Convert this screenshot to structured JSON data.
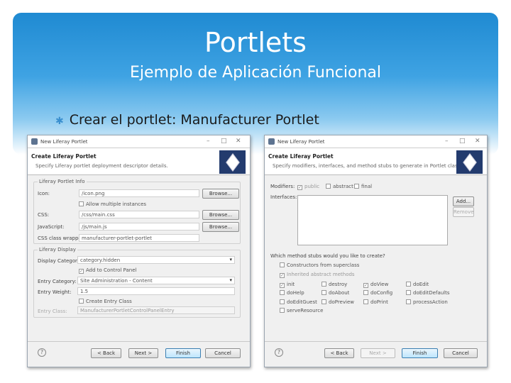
{
  "slide": {
    "title": "Portlets",
    "subtitle": "Ejemplo de Aplicación Funcional",
    "bullet": "Crear el portlet: Manufacturer Portlet"
  },
  "dialog1": {
    "window_title": "New Liferay Portlet",
    "header_title": "Create Liferay Portlet",
    "header_desc": "Specify Liferay portlet deployment descriptor details.",
    "group_info": "Liferay Portlet Info",
    "icon_label": "Icon:",
    "icon_value": "/icon.png",
    "allow_multiple": "Allow multiple instances",
    "css_label": "CSS:",
    "css_value": "/css/main.css",
    "js_label": "JavaScript:",
    "js_value": "/js/main.js",
    "wrapper_label": "CSS class wrapper:",
    "wrapper_value": "manufacturer-portlet-portlet",
    "browse": "Browse...",
    "group_display": "Liferay Display",
    "display_category_label": "Display Category:",
    "display_category_value": "category.hidden",
    "add_control_panel": "Add to Control Panel",
    "entry_category_label": "Entry Category:",
    "entry_category_value": "Site Administration - Content",
    "entry_weight_label": "Entry Weight:",
    "entry_weight_value": "1.5",
    "create_entry_class": "Create Entry Class",
    "entry_class_label": "Entry Class:",
    "entry_class_value": "ManufacturerPortletControlPanelEntry",
    "back": "< Back",
    "next": "Next >",
    "finish": "Finish",
    "cancel": "Cancel"
  },
  "dialog2": {
    "window_title": "New Liferay Portlet",
    "header_title": "Create Liferay Portlet",
    "header_desc": "Specify modifiers, interfaces, and method stubs to generate in Portlet class.",
    "modifiers_label": "Modifiers:",
    "mod_public": "public",
    "mod_abstract": "abstract",
    "mod_final": "final",
    "interfaces_label": "Interfaces:",
    "add": "Add...",
    "remove": "Remove",
    "stubs_question": "Which method stubs would you like to create?",
    "constructors": "Constructors from superclass",
    "inherited": "Inherited abstract methods",
    "methods": [
      {
        "label": "init",
        "checked": true
      },
      {
        "label": "destroy",
        "checked": false
      },
      {
        "label": "doView",
        "checked": true
      },
      {
        "label": "doEdit",
        "checked": false
      },
      {
        "label": "doHelp",
        "checked": false
      },
      {
        "label": "doAbout",
        "checked": false
      },
      {
        "label": "doConfig",
        "checked": false
      },
      {
        "label": "doEditDefaults",
        "checked": false
      },
      {
        "label": "doEditGuest",
        "checked": false
      },
      {
        "label": "doPreview",
        "checked": false
      },
      {
        "label": "doPrint",
        "checked": false
      },
      {
        "label": "processAction",
        "checked": false
      },
      {
        "label": "serveResource",
        "checked": false
      }
    ],
    "back": "< Back",
    "next": "Next >",
    "finish": "Finish",
    "cancel": "Cancel"
  }
}
